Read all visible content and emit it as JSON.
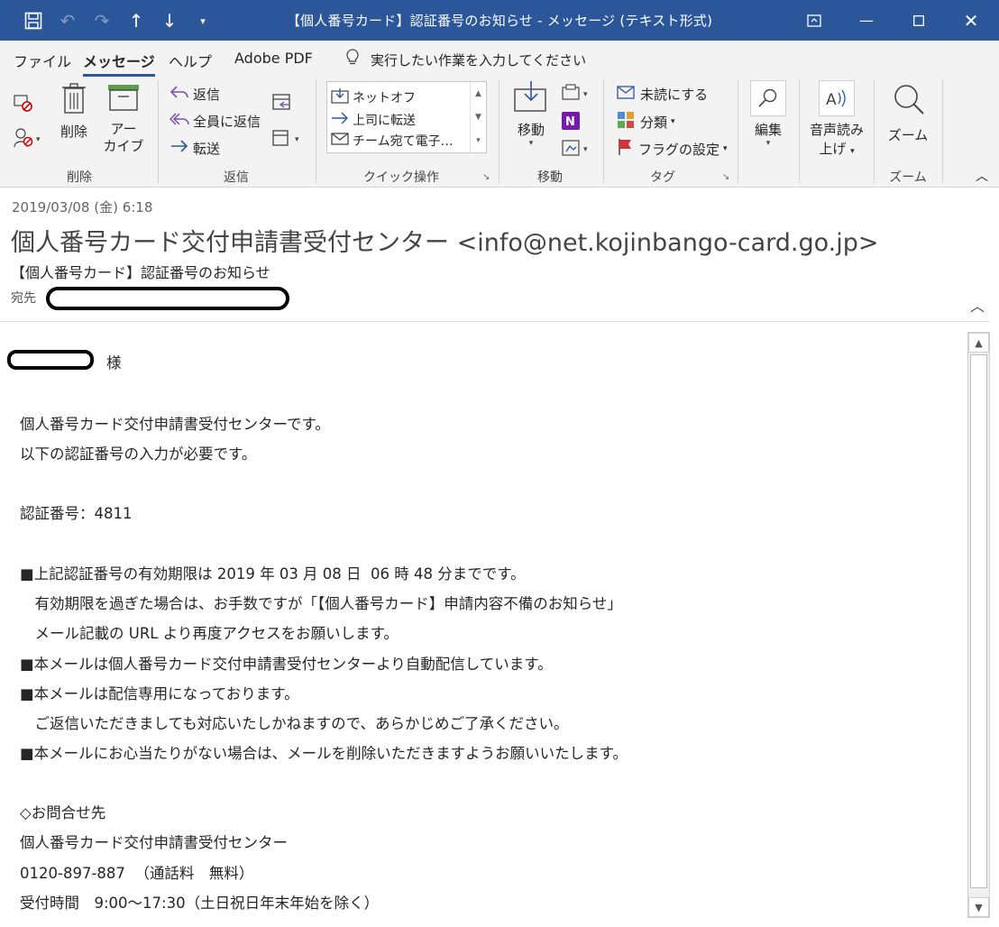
{
  "titlebar": {
    "title": "【個人番号カード】認証番号のお知らせ - メッセージ (テキスト形式)"
  },
  "tabs": [
    "ファイル",
    "メッセージ",
    "ヘルプ",
    "Adobe PDF"
  ],
  "tellme": "実行したい作業を入力してください",
  "ribbon": {
    "delete_group": {
      "delete": "削除",
      "archive_line1": "アー",
      "archive_line2": "カイブ",
      "label": "削除"
    },
    "respond_group": {
      "reply": "返信",
      "reply_all": "全員に返信",
      "forward": "転送",
      "label": "返信"
    },
    "quick_steps": {
      "items": [
        "ネットオフ",
        "上司に転送",
        "チーム宛て電子…"
      ],
      "label": "クイック操作"
    },
    "move_group": {
      "move": "移動",
      "label": "移動"
    },
    "tags_group": {
      "unread": "未読にする",
      "categorize": "分類",
      "flag": "フラグの設定",
      "label": "タグ"
    },
    "edit_group": {
      "edit": "編集"
    },
    "speech_group": {
      "line1": "音声読み",
      "line2": "上げ"
    },
    "zoom_group": {
      "zoom": "ズーム",
      "label": "ズーム"
    }
  },
  "header": {
    "date": "2019/03/08 (金) 6:18",
    "from": "個人番号カード交付申請書受付センター <info@net.kojinbango-card.go.jp>",
    "subject": "【個人番号カード】認証番号のお知らせ",
    "to_label": "宛先"
  },
  "body": {
    "salutation": "様",
    "lines": [
      "個人番号カード交付申請書受付センターです。",
      "以下の認証番号の入力が必要です。",
      "認証番号：4811",
      "■上記認証番号の有効期限は 2019 年 03 月 08 日  06 時 48 分までです。",
      "　有効期限を過ぎた場合は、お手数ですが「【個人番号カード】申請内容不備のお知らせ」",
      "　メール記載の URL より再度アクセスをお願いします。",
      "■本メールは個人番号カード交付申請書受付センターより自動配信しています。",
      "■本メールは配信専用になっております。",
      "　ご返信いただきましても対応いたしかねますので、あらかじめご了承ください。",
      "■本メールにお心当たりがない場合は、メールを削除いただきますようお願いいたします。",
      "◇お問合せ先",
      "個人番号カード交付申請書受付センター",
      "0120-897-887  （通話料　無料）",
      "受付時間　9:00～17:30（土日祝日年末年始を除く）"
    ]
  }
}
